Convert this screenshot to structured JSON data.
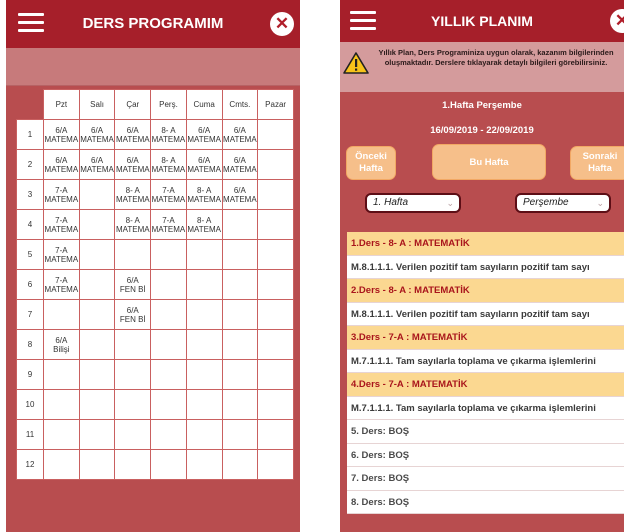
{
  "left": {
    "title": "DERS PROGRAMIM",
    "days": [
      "Pzt",
      "Salı",
      "Çar",
      "Perş.",
      "Cuma",
      "Cmts.",
      "Pazar"
    ],
    "rows": [
      {
        "n": "1",
        "cells": [
          "6/A\nMATEMA",
          "6/A\nMATEMA",
          "6/A\nMATEMA",
          "8- A\nMATEMA",
          "6/A\nMATEMA",
          "6/A\nMATEMA",
          ""
        ]
      },
      {
        "n": "2",
        "cells": [
          "6/A\nMATEMA",
          "6/A\nMATEMA",
          "6/A\nMATEMA",
          "8- A\nMATEMA",
          "6/A\nMATEMA",
          "6/A\nMATEMA",
          ""
        ]
      },
      {
        "n": "3",
        "cells": [
          "7-A\nMATEMA",
          "",
          "8- A\nMATEMA",
          "7-A\nMATEMA",
          "8- A\nMATEMA",
          "6/A\nMATEMA",
          ""
        ]
      },
      {
        "n": "4",
        "cells": [
          "7-A\nMATEMA",
          "",
          "8- A\nMATEMA",
          "7-A\nMATEMA",
          "8- A\nMATEMA",
          "",
          ""
        ]
      },
      {
        "n": "5",
        "cells": [
          "7-A\nMATEMA",
          "",
          "",
          "",
          "",
          "",
          ""
        ]
      },
      {
        "n": "6",
        "cells": [
          "7-A\nMATEMA",
          "",
          "6/A\nFEN Bİ",
          "",
          "",
          "",
          ""
        ]
      },
      {
        "n": "7",
        "cells": [
          "",
          "",
          "6/A\nFEN Bİ",
          "",
          "",
          "",
          ""
        ]
      },
      {
        "n": "8",
        "cells": [
          "6/A\nBilişi",
          "",
          "",
          "",
          "",
          "",
          ""
        ]
      },
      {
        "n": "9",
        "cells": [
          "",
          "",
          "",
          "",
          "",
          "",
          ""
        ]
      },
      {
        "n": "10",
        "cells": [
          "",
          "",
          "",
          "",
          "",
          "",
          ""
        ]
      },
      {
        "n": "11",
        "cells": [
          "",
          "",
          "",
          "",
          "",
          "",
          ""
        ]
      },
      {
        "n": "12",
        "cells": [
          "",
          "",
          "",
          "",
          "",
          "",
          ""
        ]
      }
    ]
  },
  "right": {
    "title": "YILLIK PLANIM",
    "warning": "Yıllık Plan, Ders Programiniza uygun olarak, kazanım bilgilerinden oluşmaktadır. Derslere tıklayarak detaylı bilgileri görebilirsiniz.",
    "week_title": "1.Hafta Perşembe",
    "date_range": "16/09/2019 - 22/09/2019",
    "prev_button": "Önceki Hafta",
    "this_week_button": "Bu Hafta",
    "next_button": "Sonraki Hafta",
    "week_select": "1. Hafta",
    "day_select": "Perşembe",
    "lessons": [
      {
        "type": "head",
        "text": "1.Ders - 8- A : MATEMATİK"
      },
      {
        "type": "body",
        "text": "M.8.1.1.1. Verilen pozitif tam sayıların pozitif tam sayı"
      },
      {
        "type": "head",
        "text": "2.Ders - 8- A : MATEMATİK"
      },
      {
        "type": "body",
        "text": "M.8.1.1.1. Verilen pozitif tam sayıların pozitif tam sayı"
      },
      {
        "type": "head",
        "text": "3.Ders - 7-A : MATEMATİK"
      },
      {
        "type": "body",
        "text": "M.7.1.1.1. Tam sayılarla toplama ve çıkarma işlemlerini"
      },
      {
        "type": "head",
        "text": "4.Ders - 7-A : MATEMATİK"
      },
      {
        "type": "body",
        "text": "M.7.1.1.1. Tam sayılarla toplama ve çıkarma işlemlerini"
      },
      {
        "type": "empty",
        "text": "5. Ders: BOŞ"
      },
      {
        "type": "empty",
        "text": "6. Ders: BOŞ"
      },
      {
        "type": "empty",
        "text": "7. Ders: BOŞ"
      },
      {
        "type": "empty",
        "text": "8. Ders: BOŞ"
      }
    ]
  }
}
